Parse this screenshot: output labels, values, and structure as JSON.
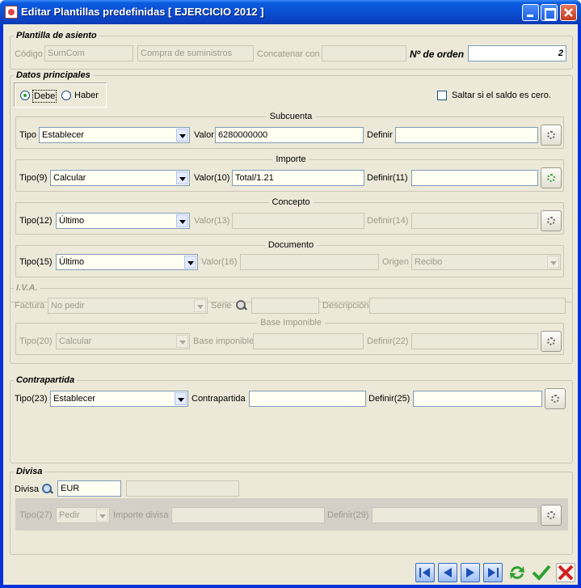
{
  "window": {
    "title": "Editar Plantillas predefinidas [ EJERCICIO 2012 ]"
  },
  "plantilla": {
    "title": "Plantilla de asiento",
    "codigo_label": "Código",
    "codigo_value": "SumCom",
    "descripcion_value": "Compra de suministros",
    "concatenar_label": "Concatenar con",
    "concatenar_value": "",
    "orden_label": "Nº de orden",
    "orden_value": "2"
  },
  "principales": {
    "title": "Datos principales",
    "debe_label": "Debe",
    "haber_label": "Haber",
    "saltar_label": "Saltar si el saldo es cero.",
    "subcuenta": {
      "caption": "Subcuenta",
      "tipo_label": "Tipo",
      "tipo_value": "Establecer",
      "valor_label": "Valor",
      "valor_value": "6280000000",
      "definir_label": "Definir",
      "definir_value": ""
    },
    "importe": {
      "caption": "Importe",
      "tipo_label": "Tipo(9)",
      "tipo_value": "Calcular",
      "valor_label": "Valor(10)",
      "valor_value": "Total/1.21",
      "definir_label": "Definir(11)",
      "definir_value": ""
    },
    "concepto": {
      "caption": "Concepto",
      "tipo_label": "Tipo(12)",
      "tipo_value": "Último",
      "valor_label": "Valor(13)",
      "valor_value": "",
      "definir_label": "Definir(14)",
      "definir_value": ""
    },
    "documento": {
      "caption": "Documento",
      "tipo_label": "Tipo(15)",
      "tipo_value": "Último",
      "valor_label": "Valor(16)",
      "valor_value": "",
      "origen_label": "Origen",
      "origen_value": "Recibo"
    }
  },
  "iva": {
    "title": "I.V.A.",
    "factura_label": "Factura",
    "factura_value": "No pedir",
    "serie_label": "Serie",
    "serie_value": "",
    "descripcion_label": "Descripción",
    "descripcion_value": "",
    "base": {
      "caption": "Base Imponible",
      "tipo_label": "Tipo(20)",
      "tipo_value": "Calcular",
      "base_label": "Base imponible",
      "base_value": "",
      "definir_label": "Definir(22)",
      "definir_value": ""
    }
  },
  "contrapartida": {
    "title": "Contrapartida",
    "tipo_label": "Tipo(23)",
    "tipo_value": "Establecer",
    "contra_label": "Contrapartida",
    "contra_value": "",
    "definir_label": "Definir(25)",
    "definir_value": ""
  },
  "divisa": {
    "title": "Divisa",
    "divisa_label": "Divisa",
    "divisa_value": "EUR",
    "divisa_desc": "",
    "tipo_label": "Tipo(27)",
    "tipo_value": "Pedir",
    "importe_label": "Importe divisa",
    "importe_value": "",
    "definir_label": "Definir(29)",
    "definir_value": ""
  },
  "toolbar": {
    "icons": [
      "first-icon",
      "prev-icon",
      "next-icon",
      "last-icon",
      "refresh-icon",
      "accept-icon",
      "cancel-icon"
    ]
  }
}
